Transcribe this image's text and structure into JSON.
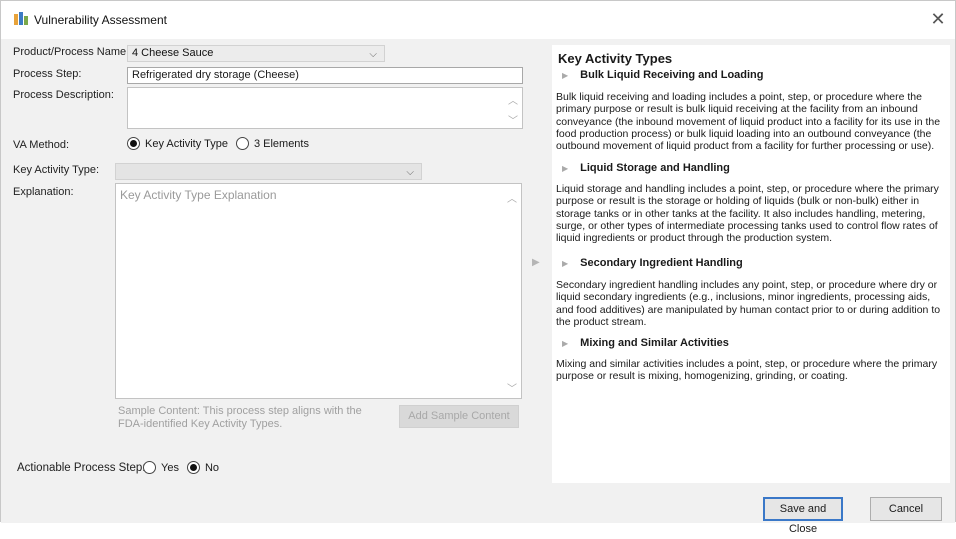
{
  "window": {
    "title": "Vulnerability Assessment"
  },
  "form": {
    "product_label": "Product/Process Name:",
    "product_value": "4 Cheese Sauce",
    "step_label": "Process Step:",
    "step_value": "Refrigerated dry storage (Cheese)",
    "description_label": "Process Description:",
    "description_value": "",
    "va_method_label": "VA Method:",
    "va_method_options": [
      "Key Activity Type",
      "3 Elements"
    ],
    "va_method_selected": "Key Activity Type",
    "kat_label": "Key Activity Type:",
    "kat_value": "",
    "explanation_label": "Explanation:",
    "explanation_placeholder": "Key Activity Type Explanation",
    "sample_text": "Sample Content: This process step aligns with the FDA-identified Key Activity Types.",
    "add_sample_label": "Add Sample Content",
    "actionable_label": "Actionable Process Step:",
    "actionable_options": [
      "Yes",
      "No"
    ],
    "actionable_selected": "No"
  },
  "help": {
    "title": "Key Activity Types",
    "sections": [
      {
        "heading": "Bulk Liquid Receiving and Loading",
        "body": "Bulk liquid receiving and loading includes a point, step, or procedure where the primary purpose or result is bulk liquid receiving at the facility from an inbound conveyance (the inbound movement of liquid product into a facility for its use in the food production process) or bulk liquid loading into an outbound conveyance (the outbound movement of liquid product from a facility for further processing or use)."
      },
      {
        "heading": "Liquid Storage and Handling",
        "body": "Liquid storage and handling includes a point, step, or procedure where the primary purpose or result is the storage or holding of liquids (bulk or non-bulk) either in storage tanks or in other tanks at the facility.  It also includes handling, metering, surge, or other types of intermediate processing tanks used to control flow rates of liquid ingredients or product through the production system."
      },
      {
        "heading": "Secondary Ingredient Handling",
        "body": "Secondary ingredient handling includes any point, step, or procedure where dry or liquid secondary ingredients (e.g., inclusions, minor ingredients, processing aids, and food additives) are manipulated by human contact prior to or during addition to the product stream."
      },
      {
        "heading": "Mixing and Similar Activities",
        "body": "Mixing and similar activities includes a point, step, or procedure where the primary purpose or result is mixing, homogenizing, grinding, or coating."
      }
    ]
  },
  "footer": {
    "save_label": "Save and Close",
    "cancel_label": "Cancel"
  },
  "colors": {
    "accent": "#3a78c8",
    "panel_bg": "#f1f1f1"
  }
}
